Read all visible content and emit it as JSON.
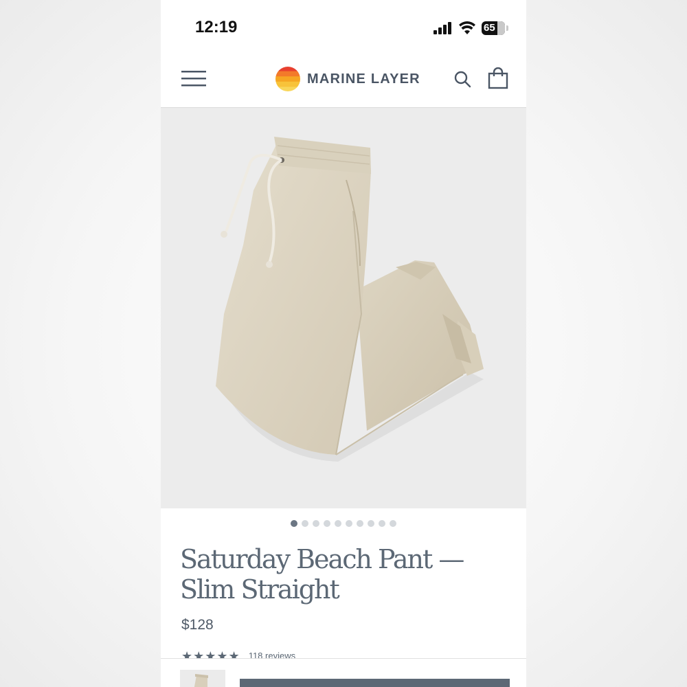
{
  "status_bar": {
    "time": "12:19",
    "battery": "65"
  },
  "header": {
    "brand": "MARINE LAYER",
    "logo_colors": [
      "#e8402f",
      "#f37a2a",
      "#f6a623",
      "#f8c33a",
      "#f9d65a"
    ]
  },
  "icons": {
    "menu": "hamburger-icon",
    "search": "search-icon",
    "bag": "shopping-bag-icon",
    "signal": "cellular-signal-icon",
    "wifi": "wifi-icon"
  },
  "carousel": {
    "total": 10,
    "active_index": 0
  },
  "product": {
    "title": "Saturday Beach Pant — Slim Straight",
    "price": "$128",
    "rating_stars": "★★★★★",
    "reviews": "118 reviews",
    "color_hex": "#ddd5c3"
  },
  "colors": {
    "accent": "#5c6875",
    "text": "#4f5a67"
  }
}
